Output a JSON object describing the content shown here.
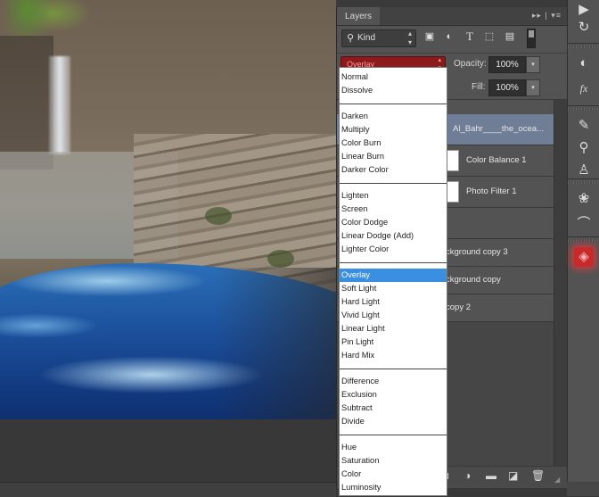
{
  "canvas": {
    "description": "Composite photo: waterfall in a rocky canyon with blue ocean waves in the foreground"
  },
  "panel": {
    "tab_label": "Layers",
    "tab_controls_icon": "double-arrow-and-menu-icon",
    "filter": {
      "kind_label": "Kind",
      "icons": [
        "image-filter-icon",
        "adjustment-filter-icon",
        "type-filter-icon",
        "shape-filter-icon",
        "smart-object-filter-icon"
      ]
    },
    "blend_mode": {
      "selected": "Overlay"
    },
    "opacity": {
      "label": "Opacity:",
      "value": "100%"
    },
    "fill": {
      "label": "Fill:",
      "value": "100%"
    },
    "layers": [
      {
        "name": "Al_Bahr____the_ocea...",
        "selected": true,
        "has_mask": false
      },
      {
        "name": "Color Balance 1",
        "selected": false,
        "has_mask": true
      },
      {
        "name": "Photo Filter 1",
        "selected": false,
        "has_mask": true
      },
      {
        "name": "",
        "selected": false,
        "has_mask": false
      },
      {
        "name": "ckground copy 3",
        "selected": false,
        "has_mask": false
      },
      {
        "name": "ckground copy",
        "selected": false,
        "has_mask": false
      },
      {
        "name": "copy 2",
        "selected": false,
        "has_mask": false
      }
    ],
    "bottom_icons": [
      "add-mask-icon",
      "adjustment-layer-icon",
      "new-group-icon",
      "new-layer-icon",
      "delete-icon"
    ]
  },
  "blend_menu": {
    "groups": [
      [
        "Normal",
        "Dissolve"
      ],
      [
        "Darken",
        "Multiply",
        "Color Burn",
        "Linear Burn",
        "Darker Color"
      ],
      [
        "Lighten",
        "Screen",
        "Color Dodge",
        "Linear Dodge (Add)",
        "Lighter Color"
      ],
      [
        "Overlay",
        "Soft Light",
        "Hard Light",
        "Vivid Light",
        "Linear Light",
        "Pin Light",
        "Hard Mix"
      ],
      [
        "Difference",
        "Exclusion",
        "Subtract",
        "Divide"
      ],
      [
        "Hue",
        "Saturation",
        "Color",
        "Luminosity"
      ]
    ],
    "highlighted": "Overlay",
    "highlight_color": "#3b8fe0"
  },
  "toolstrip": {
    "tools": [
      {
        "name": "play-action-icon",
        "glyph": "▶"
      },
      {
        "name": "history-icon",
        "glyph": "↻"
      },
      {
        "name": "adjustments-icon",
        "glyph": "◐"
      },
      {
        "name": "styles-fx-icon",
        "glyph": "fx"
      },
      {
        "name": "brushes-icon",
        "glyph": "✎"
      },
      {
        "name": "brush-presets-icon",
        "glyph": "⚲"
      },
      {
        "name": "clone-source-icon",
        "glyph": "♙"
      },
      {
        "name": "channels-icon",
        "glyph": "❀"
      },
      {
        "name": "paths-icon",
        "glyph": "⌒"
      },
      {
        "name": "layers-icon",
        "glyph": "◈",
        "active": true
      }
    ],
    "accent_color": "#c62a2a"
  }
}
